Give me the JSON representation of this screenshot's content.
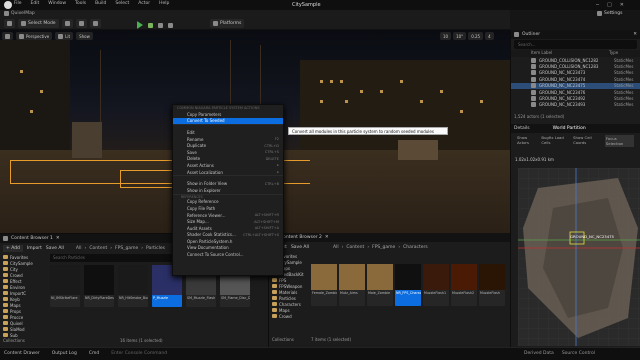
{
  "title_bar": {
    "app_title": "CitySample",
    "menu": [
      "File",
      "Edit",
      "Window",
      "Tools",
      "Build",
      "Select",
      "Actor",
      "Help"
    ],
    "map_name": "QuixelMap"
  },
  "toolbar": {
    "select_mode": "Select Mode",
    "platforms": "Platforms",
    "settings": "Settings"
  },
  "viewport": {
    "perspective": "Perspective",
    "lit": "Lit",
    "show": "Show",
    "grid_snap": "10",
    "angle_snap": "10°",
    "scale_snap": "0.25",
    "camera_speed": "4"
  },
  "context_menu": {
    "header": "COMMON NIAGARA PARTICLE SYSTEM ACTIONS",
    "items_top": [
      {
        "label": "Copy Parameters",
        "key": ""
      },
      {
        "label": "Convert To Seeded",
        "key": "",
        "highlighted": true
      }
    ],
    "edit_items": [
      {
        "label": "Edit",
        "key": ""
      },
      {
        "label": "Rename",
        "key": "F2"
      },
      {
        "label": "Duplicate",
        "key": "CTRL+D"
      },
      {
        "label": "Save",
        "key": "CTRL+S"
      },
      {
        "label": "Delete",
        "key": "DELETE"
      },
      {
        "label": "Asset Actions",
        "key": "▸"
      },
      {
        "label": "Asset Localization",
        "key": "▸"
      }
    ],
    "explore_items": [
      {
        "label": "Show in Folder View",
        "key": "CTRL+B"
      },
      {
        "label": "Show in Explorer",
        "key": ""
      }
    ],
    "ref_section": "REFERENCES",
    "ref_items": [
      {
        "label": "Copy Reference",
        "key": ""
      },
      {
        "label": "Copy File Path",
        "key": ""
      },
      {
        "label": "Reference Viewer...",
        "key": "ALT+SHIFT+R"
      },
      {
        "label": "Size Map...",
        "key": "ALT+SHIFT+M"
      },
      {
        "label": "Audit Assets",
        "key": "ALT+SHIFT+A"
      },
      {
        "label": "Shader Cook Statistics...",
        "key": "CTRL+ALT+SHIFT+S"
      },
      {
        "label": "Open ParticleSystem.h",
        "key": ""
      },
      {
        "label": "View Documentation",
        "key": ""
      },
      {
        "label": "Connect To Source Control...",
        "key": ""
      }
    ]
  },
  "tooltip": "Convert all modules in this particle system to random seeded modules",
  "outliner": {
    "tab": "Outliner",
    "search_placeholder": "Search...",
    "col_label": "Item Label",
    "col_type": "Type",
    "rows": [
      {
        "label": "GROUND_COLLISION_NC1282",
        "type": "StaticMes",
        "selected": false
      },
      {
        "label": "GROUND_COLLISION_NC1283",
        "type": "StaticMes",
        "selected": false
      },
      {
        "label": "GROUND_NC_NC23473",
        "type": "StaticMes",
        "selected": false
      },
      {
        "label": "GROUND_NC_NC23474",
        "type": "StaticMes",
        "selected": false
      },
      {
        "label": "GROUND_NC_NC23475",
        "type": "StaticMes",
        "selected": true
      },
      {
        "label": "GROUND_NC_NC23476",
        "type": "StaticMes",
        "selected": false
      },
      {
        "label": "GROUND_NC_NC23492",
        "type": "StaticMes",
        "selected": false
      },
      {
        "label": "GROUND_NC_NC23493",
        "type": "StaticMes",
        "selected": false
      }
    ],
    "count": "1,524 actors (1 selected)"
  },
  "details": {
    "tabs": [
      "Details",
      "World Partition"
    ],
    "cols": [
      "Show Actors",
      "Bugfix Load Cells",
      "Show Cell Coords",
      "Focus Selection"
    ],
    "coords": "1.02x1.02x0.91 km",
    "map_label": "GROUND_NC_NC23475"
  },
  "content_browser_1": {
    "tab": "Content Browser 1",
    "add": "Add",
    "import": "Import",
    "save_all": "Save All",
    "path": [
      "All",
      "Content",
      "FPS_game",
      "Particles"
    ],
    "tree": [
      "Favorites",
      "CitySample",
      "City",
      "Crowd",
      "Effect",
      "Environ",
      "ImportC",
      "Keyb",
      "Maps",
      "Props",
      "Procce",
      "Quixel",
      "SlaMod",
      "Sub"
    ],
    "search_placeholder": "Search Particles",
    "assets": [
      {
        "label": "NI_IMStrikeFlare"
      },
      {
        "label": "NR_DirtyFlareDesc"
      },
      {
        "label": "NR_HitSmoke_Burst"
      },
      {
        "label": "P_Muzzle",
        "selected": true
      },
      {
        "label": "SM_Muzzle_Flash"
      },
      {
        "label": "SM_Flame_Disc_Dark"
      }
    ],
    "count": "16 items (1 selected)",
    "collections": "Collections",
    "item_count_label": "19 items"
  },
  "content_browser_2": {
    "tab": "Content Browser 2",
    "import": "Import",
    "save_all": "Save All",
    "path": [
      "All",
      "Content",
      "FPS_game",
      "Characters"
    ],
    "tree": [
      "Favorites",
      "CitySample",
      "Props",
      "FeedBackKit",
      "FPS",
      "FPSWeapon",
      "Materials",
      "Particles",
      "Characters",
      "Maps",
      "Crowd"
    ],
    "assets": [
      {
        "label": "Female_Zombie"
      },
      {
        "label": "Mutz_Aims"
      },
      {
        "label": "Male_Zombie"
      },
      {
        "label": "NR_FPS_Character",
        "selected": true
      },
      {
        "label": "MuzzleFlash1"
      },
      {
        "label": "MuzzleFlash2"
      },
      {
        "label": "MuzzleFlash"
      }
    ],
    "collections": "Collections",
    "count": "7 items (1 selected)"
  },
  "status_bar": {
    "content_drawer": "Content Drawer",
    "output_log": "Output Log",
    "cmd": "Cmd",
    "console_placeholder": "Enter Console Command",
    "derived_data": "Derived Data",
    "source_control": "Source Control"
  },
  "colors": {
    "accent": "#0c6de0",
    "selection_outline": "#e79b2a",
    "tooltip_bg": "#fafafa"
  }
}
